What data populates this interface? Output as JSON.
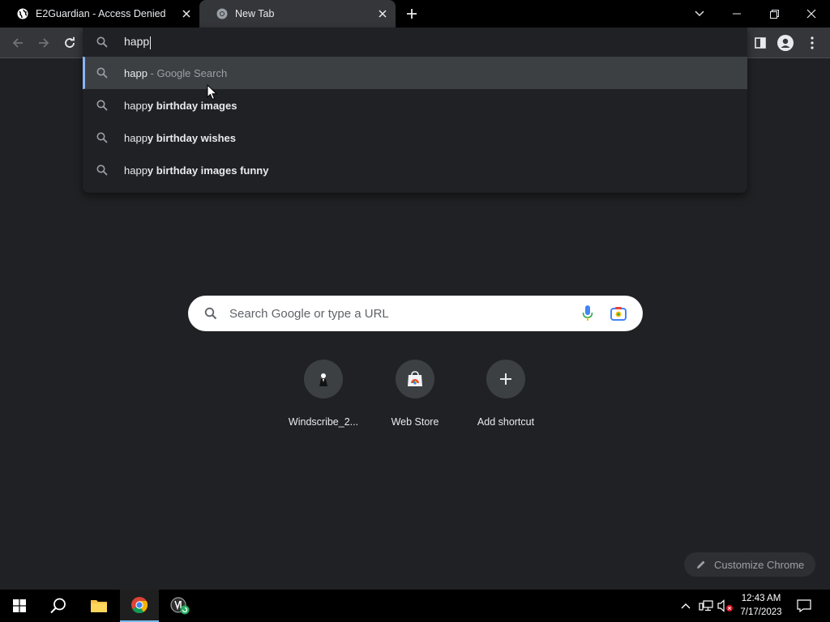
{
  "tabs": [
    {
      "title": "E2Guardian - Access Denied",
      "icon": "globe-icon",
      "active": false
    },
    {
      "title": "New Tab",
      "icon": "chrome-icon",
      "active": true
    }
  ],
  "omnibox": {
    "value": "happ",
    "suggestions": [
      {
        "typed": "happ",
        "rest": "",
        "note": " - Google Search"
      },
      {
        "typed": "happ",
        "rest": "y birthday images",
        "note": ""
      },
      {
        "typed": "happ",
        "rest": "y birthday wishes",
        "note": ""
      },
      {
        "typed": "happ",
        "rest": "y birthday images funny",
        "note": ""
      }
    ]
  },
  "ntp": {
    "search_placeholder": "Search Google or type a URL",
    "shortcuts": [
      {
        "label": "Windscribe_2...",
        "icon": "windscribe-icon"
      },
      {
        "label": "Web Store",
        "icon": "webstore-icon"
      },
      {
        "label": "Add shortcut",
        "icon": "plus-icon"
      }
    ],
    "customize_label": "Customize Chrome"
  },
  "taskbar": {
    "time": "12:43 AM",
    "date": "7/17/2023"
  },
  "colors": {
    "accent": "#8ab4f8",
    "background": "#202124",
    "toolbar": "#35363a"
  }
}
